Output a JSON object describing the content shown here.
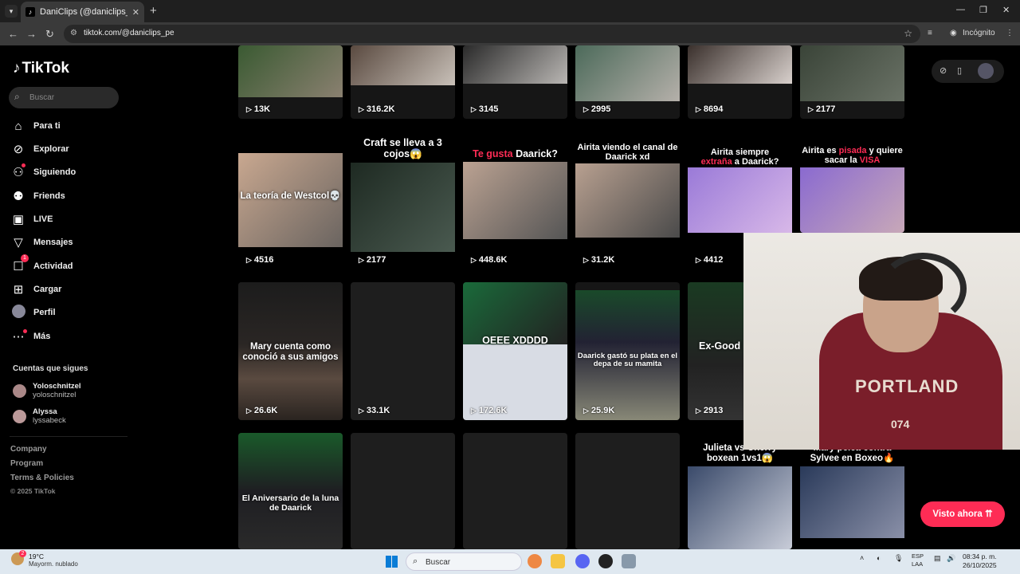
{
  "browser": {
    "tab_title": "DaniClips (@daniclips_pe) | TikTok",
    "url": "tiktok.com/@daniclips_pe",
    "profile_label": "Incógnito"
  },
  "sidebar": {
    "logo": "TikTok",
    "search_placeholder": "Buscar",
    "items": [
      {
        "label": "Para ti",
        "icon": "home-icon"
      },
      {
        "label": "Explorar",
        "icon": "compass-icon"
      },
      {
        "label": "Siguiendo",
        "icon": "following-icon"
      },
      {
        "label": "Friends",
        "icon": "friends-icon"
      },
      {
        "label": "LIVE",
        "icon": "live-icon"
      },
      {
        "label": "Mensajes",
        "icon": "messages-icon"
      },
      {
        "label": "Actividad",
        "icon": "activity-icon",
        "badge": "1"
      },
      {
        "label": "Cargar",
        "icon": "upload-icon"
      },
      {
        "label": "Perfil",
        "icon": "profile-icon"
      },
      {
        "label": "Más",
        "icon": "more-icon"
      }
    ],
    "following_title": "Cuentas que sigues",
    "following": [
      {
        "name": "Yoloschnitzel",
        "handle": "yoloschnitzel"
      },
      {
        "name": "Alyssa",
        "handle": "lyssabeck"
      }
    ],
    "footer": [
      "Company",
      "Program",
      "Terms & Policies"
    ],
    "copyright": "© 2025 TikTok"
  },
  "grid": {
    "row1": [
      "13K",
      "316.2K",
      "3145",
      "2995",
      "8694",
      "2177"
    ],
    "row2": [
      {
        "views": "4516",
        "caption": "La teoría de Westcol💀"
      },
      {
        "views": "2177",
        "caption": "Craft se lleva a 3 cojos😱"
      },
      {
        "views": "448.6K",
        "caption_pre": "Te gusta",
        "caption_post": " Daarick?"
      },
      {
        "views": "31.2K",
        "caption": "Airita viendo el canal de Daarick xd"
      },
      {
        "views": "4412",
        "caption_a": "Airita siempre",
        "caption_b_hl": "extraña",
        "caption_b": " a Daarick?"
      },
      {
        "views": "",
        "caption_a": "Airita es ",
        "caption_a_hl": "pisada",
        "caption_a2": " y quiere sacar la ",
        "caption_b_hl": "VISA"
      }
    ],
    "row3": [
      {
        "views": "26.6K",
        "caption": "Mary cuenta como conoció a sus amigos"
      },
      {
        "views": "33.1K",
        "caption": ""
      },
      {
        "views": "172.6K",
        "caption": "OEEE XDDDD"
      },
      {
        "views": "25.9K",
        "caption": "Daarick gastó su plata en el depa de su mamita"
      },
      {
        "views": "2913",
        "caption": "Ex-Good"
      }
    ],
    "row4": [
      {
        "caption": "El Aniversario de la luna de Daarick"
      },
      {
        "caption": ""
      },
      {
        "caption": ""
      },
      {
        "caption": ""
      },
      {
        "caption": "Julieta vs Cherry boxean 1vs1😱"
      },
      {
        "caption": "Mary pelea contra Sylvee en Boxeo🔥"
      }
    ]
  },
  "webcam_text": {
    "print": "PORTLAND",
    "number": "074"
  },
  "visto_button": "Visto ahora",
  "taskbar": {
    "weather_temp": "19°C",
    "weather_desc": "Mayorm. nublado",
    "weather_badge": "2",
    "search": "Buscar",
    "lang1": "ESP",
    "lang2": "LAA",
    "time": "08:34 p. m.",
    "date": "26/10/2025"
  }
}
